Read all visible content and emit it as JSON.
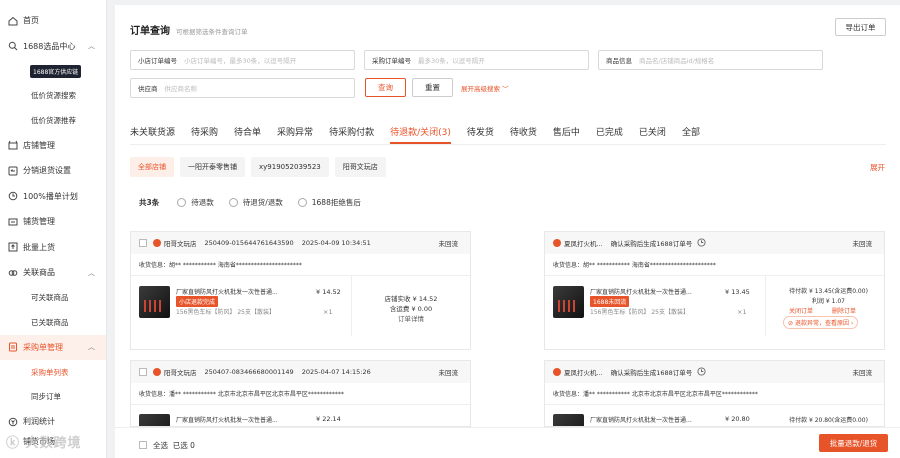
{
  "sidebar": {
    "items": [
      {
        "label": "首页",
        "icon": "home-icon"
      },
      {
        "label": "1688选品中心",
        "icon": "search-icon",
        "arrow": "^"
      },
      {
        "label": "店铺管理",
        "icon": "store-icon"
      },
      {
        "label": "分销退货设置",
        "icon": "return-icon"
      },
      {
        "label": "100%播单计划",
        "icon": "plan-icon"
      },
      {
        "label": "铺货管理",
        "icon": "distribute-icon"
      },
      {
        "label": "批量上货",
        "icon": "upload-icon"
      },
      {
        "label": "关联商品",
        "icon": "link-icon",
        "arrow": "^"
      },
      {
        "label": "采购单管理",
        "icon": "purchase-icon",
        "arrow": "^"
      },
      {
        "label": "利润统计",
        "icon": "profit-icon"
      }
    ],
    "sub_1688": [
      "1688官方供应链",
      "低价货源搜索",
      "低价货源推荐"
    ],
    "sub_link": [
      "可关联商品",
      "已关联商品"
    ],
    "sub_purchase": [
      "采购单列表",
      "同步订单"
    ],
    "cut_item": "铺货市场"
  },
  "header": {
    "title": "订单查询",
    "subtitle": "可根据筛选条件查询订单",
    "export": "导出订单"
  },
  "search": {
    "f1_label": "小店订单编号",
    "f1_ph": "小店订单编号，最多30条，以逗号隔开",
    "f2_label": "采购订单编号",
    "f2_ph": "最多30条，以逗号隔开",
    "f3_label": "商品信息",
    "f3_ph": "商品名/店铺商品id/规格名",
    "f4_label": "供应商",
    "f4_ph": "供应商名称",
    "query": "查询",
    "reset": "重置",
    "advanced": "展开高级搜索 ﹀"
  },
  "tabs": [
    "未关联货源",
    "待采购",
    "待合单",
    "采购异常",
    "待采购付款",
    "待退款/关闭(3)",
    "待发货",
    "待收货",
    "售后中",
    "已完成",
    "已关闭",
    "全部"
  ],
  "shops": [
    "全部店铺",
    "一阳开泰零售铺",
    "xy919052039523",
    "阳哥文玩店"
  ],
  "expand": "展开",
  "filters": {
    "total": "共3条",
    "options": [
      "待退款",
      "待退货/退款",
      "1688拒绝售后"
    ]
  },
  "cards": [
    {
      "shop": "阳哥文玩店",
      "order_no": "250409-015644761643590",
      "time": "2025-04-09 10:34:51",
      "status": "未回流",
      "receiver": "收货信息：胡**      ***********      海南省**********************",
      "product": "厂家直销防风打火机批发一次性普通...",
      "badge": "小店退款完成",
      "spec": "156黑色车标【防风】 25支【散装】",
      "price": "¥ 14.52",
      "qty": "×1",
      "mid1": "店铺实收 ¥ 14.52",
      "mid2": "含运费 ¥ 0.00",
      "mid3": "订单详情"
    },
    {
      "shop": "夏凤打火机...",
      "order_no": "确认采购后生成1688订单号",
      "time": "",
      "status": "未回流",
      "receiver": "收货信息：胡**      ***********      海南省**********************",
      "product": "厂家直销防风打火机批发一次性普通...",
      "badge": "1688未回流",
      "spec": "156黑色车标【防风】 25支【散装】",
      "price": "¥ 13.45",
      "qty": "×1",
      "r1": "待付款 ¥ 13.45(含运费0.00)",
      "r2": "利润 ¥ 1.07",
      "r3a": "关闭订单",
      "r3b": "删除订单",
      "r4": "退款异常，查看原因 ›"
    },
    {
      "shop": "阳哥文玩店",
      "order_no": "250407-083466680001149",
      "time": "2025-04-07 14:15:26",
      "status": "未回流",
      "receiver": "收货信息：潘**      ***********      北京市北京市昌平区北京市昌平区************",
      "product": "厂家直销防风打火机批发一次性普通...",
      "price": "¥ 22.14"
    },
    {
      "shop": "夏凤打火机...",
      "order_no": "确认采购后生成1688订单号",
      "time": "",
      "status": "未回流",
      "receiver": "收货信息：潘**      ***********      北京市北京市昌平区北京市昌平区************",
      "product": "厂家直销防风打火机批发一次性普通...",
      "price": "¥ 20.80",
      "r1": "待付款 ¥ 20.80(含运费0.00)"
    }
  ],
  "footer": {
    "select_all": "全选",
    "selected": "已选 0",
    "bulk": "批量退款/退货"
  },
  "watermark": "ⓚ 大数跨境",
  "colors": {
    "accent": "#e8542a"
  }
}
